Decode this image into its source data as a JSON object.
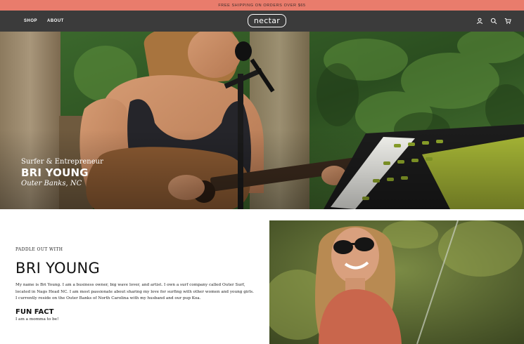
{
  "announcement": "Free shipping on orders over $65",
  "header": {
    "nav": [
      "SHOP",
      "ABOUT"
    ],
    "logo": "nectar",
    "icons": [
      "account-icon",
      "search-icon",
      "cart-icon"
    ]
  },
  "hero": {
    "subtitle": "Surfer & Entrepreneur",
    "name": "BRI YOUNG",
    "location": "Outer Banks, NC"
  },
  "profile": {
    "eyebrow": "PADDLE OUT WITH",
    "title": "BRI YOUNG",
    "bio": "My name is Bri Young. I am a business owner, big wave lover, and artist. I own a surf company called Outer Surf, located in Nags Head NC. I am most passionate about sharing my love for surfing with other women and young girls. I currently reside on the Outer Banks of North Carolina with my husband and our pup Koa.",
    "fun_fact_heading": "FUN FACT",
    "fun_fact": "I am a momma to be!"
  },
  "colors": {
    "announcement_bg": "#e97c6c",
    "header_bg": "#3b3b3b",
    "text": "#222222"
  }
}
